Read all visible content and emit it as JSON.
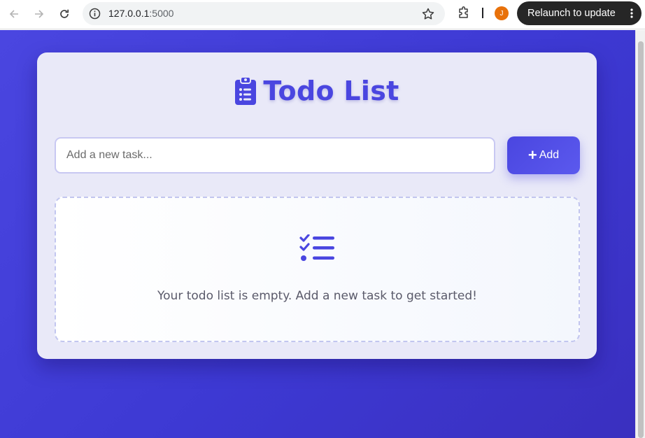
{
  "browser": {
    "url_host": "127.0.0.1",
    "url_port": ":5000",
    "profile_initial": "J",
    "relaunch_label": "Relaunch to update"
  },
  "app": {
    "title": "Todo List",
    "input_placeholder": "Add a new task...",
    "add_button_label": "Add",
    "empty_message": "Your todo list is empty. Add a new task to get started!"
  },
  "icons": {
    "title": "clipboard-list-icon",
    "empty_state": "tasks-list-icon",
    "add": "plus-icon"
  },
  "colors": {
    "accent": "#4a46e0",
    "background": "#3d39d3",
    "card": "#e9e9f8"
  }
}
